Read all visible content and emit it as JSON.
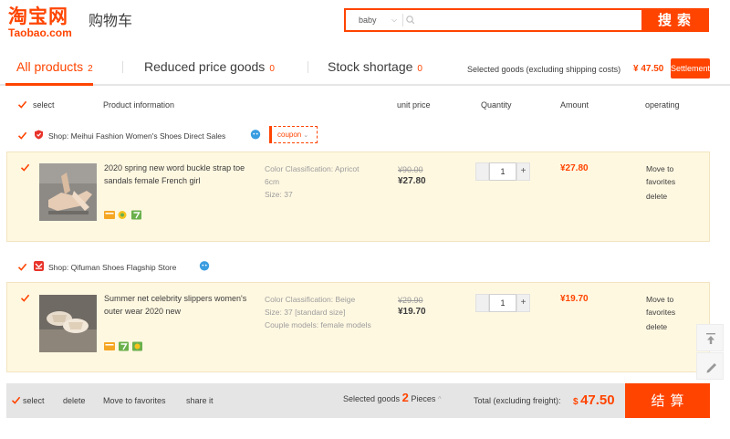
{
  "header": {
    "logo_cn": "淘宝网",
    "logo_en": "Taobao.com",
    "page_title": "购物车",
    "search": {
      "category": "baby",
      "placeholder": "",
      "button_label": "搜索"
    }
  },
  "tabs": [
    {
      "label": "All products",
      "count": "2"
    },
    {
      "label": "Reduced price goods",
      "count": "0"
    },
    {
      "label": "Stock shortage",
      "count": "0"
    }
  ],
  "summary_top": {
    "label": "Selected goods (excluding shipping costs)",
    "price": "¥ 47.50",
    "settle_label": "Settlement"
  },
  "columns": {
    "select": "select",
    "product": "Product information",
    "unit_price": "unit price",
    "quantity": "Quantity",
    "amount": "Amount",
    "operating": "operating"
  },
  "shops": [
    {
      "name": "Shop: Meihui Fashion Women's Shoes Direct Sales",
      "coupon_label": "coupon",
      "item": {
        "title": "2020 spring new word buckle strap toe sandals female French girl",
        "attrs": [
          "Color Classification: Apricot 6cm",
          "Size: 37"
        ],
        "old_price": "¥90.00",
        "price": "¥27.80",
        "quantity": "1",
        "amount": "¥27.80",
        "ops": [
          "Move to favorites",
          "delete"
        ]
      }
    },
    {
      "name": "Shop: Qifuman Shoes Flagship Store",
      "item": {
        "title": "Summer net celebrity slippers women's outer wear 2020 new",
        "attrs": [
          "Color Classification: Beige",
          "Size: 37 [standard size]",
          "Couple models: female models"
        ],
        "old_price": "¥29.90",
        "price": "¥19.70",
        "quantity": "1",
        "amount": "¥19.70",
        "ops": [
          "Move to favorites",
          "delete"
        ]
      }
    }
  ],
  "footer": {
    "select": "select",
    "delete": "delete",
    "move_fav": "Move to favorites",
    "share": "share it",
    "selected_label": "Selected goods",
    "selected_count": "2",
    "pieces": "Pieces",
    "total_label": "Total (excluding freight):",
    "total_currency": "$",
    "total": "47.50",
    "checkout_label": "结算"
  },
  "colors": {
    "accent": "#ff4400",
    "item_bg": "#fff8e1",
    "footer_bg": "#e5e5e5"
  }
}
